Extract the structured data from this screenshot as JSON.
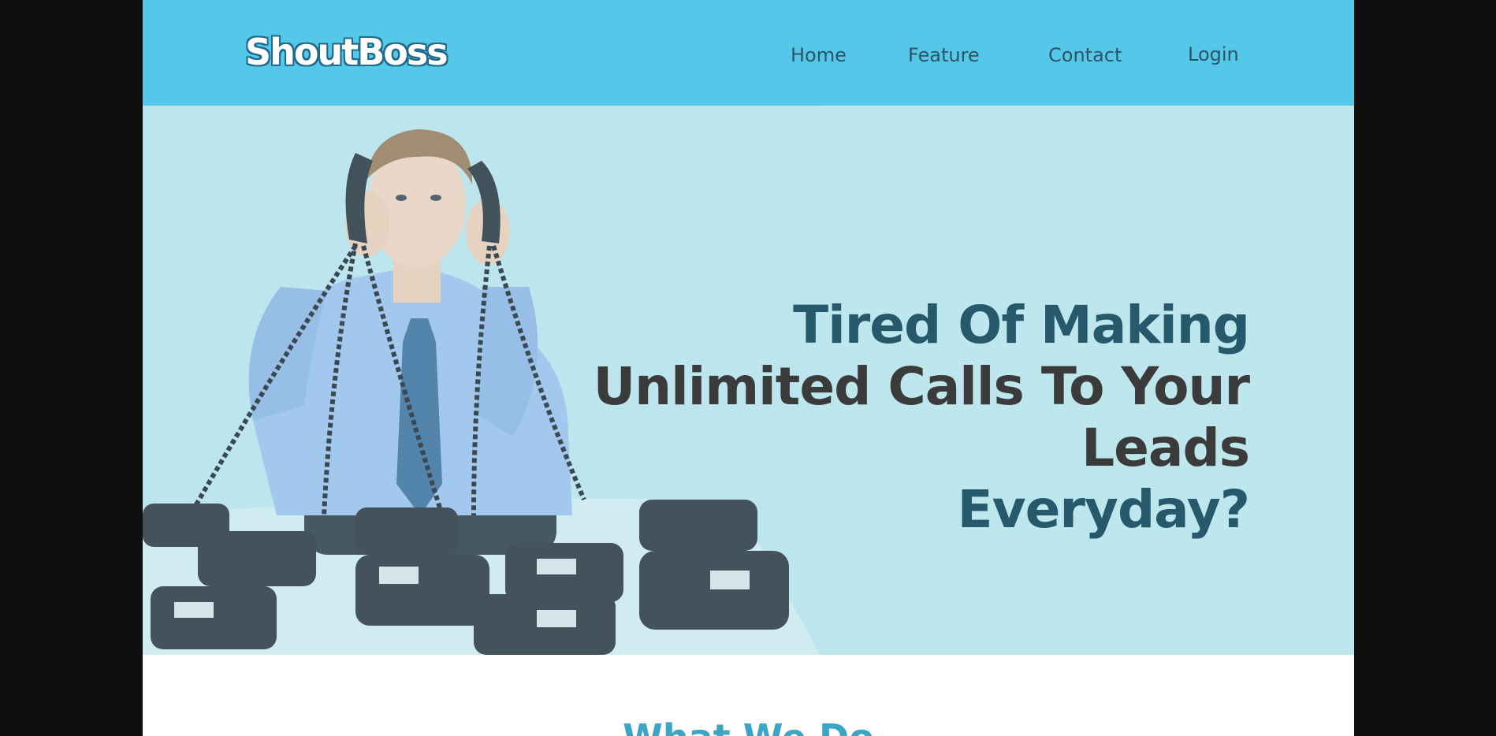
{
  "header": {
    "logo_text": "ShoutBoss",
    "nav": {
      "home": "Home",
      "feature": "Feature",
      "contact": "Contact",
      "login": "Login"
    }
  },
  "hero": {
    "title_part1": "Tired Of Making ",
    "title_part2": "Unlimited Calls To Your Leads",
    "title_part3": "Everyday?"
  },
  "section": {
    "title": "What We Do"
  },
  "colors": {
    "header_bg": "#55c8ea",
    "hero_bg": "#bde6ed",
    "title_teal": "#26596c",
    "title_dark": "#3b3b3b",
    "section_title": "#3aa5c4"
  },
  "icons": {
    "hero_image": "man-with-many-telephones-illustration"
  }
}
